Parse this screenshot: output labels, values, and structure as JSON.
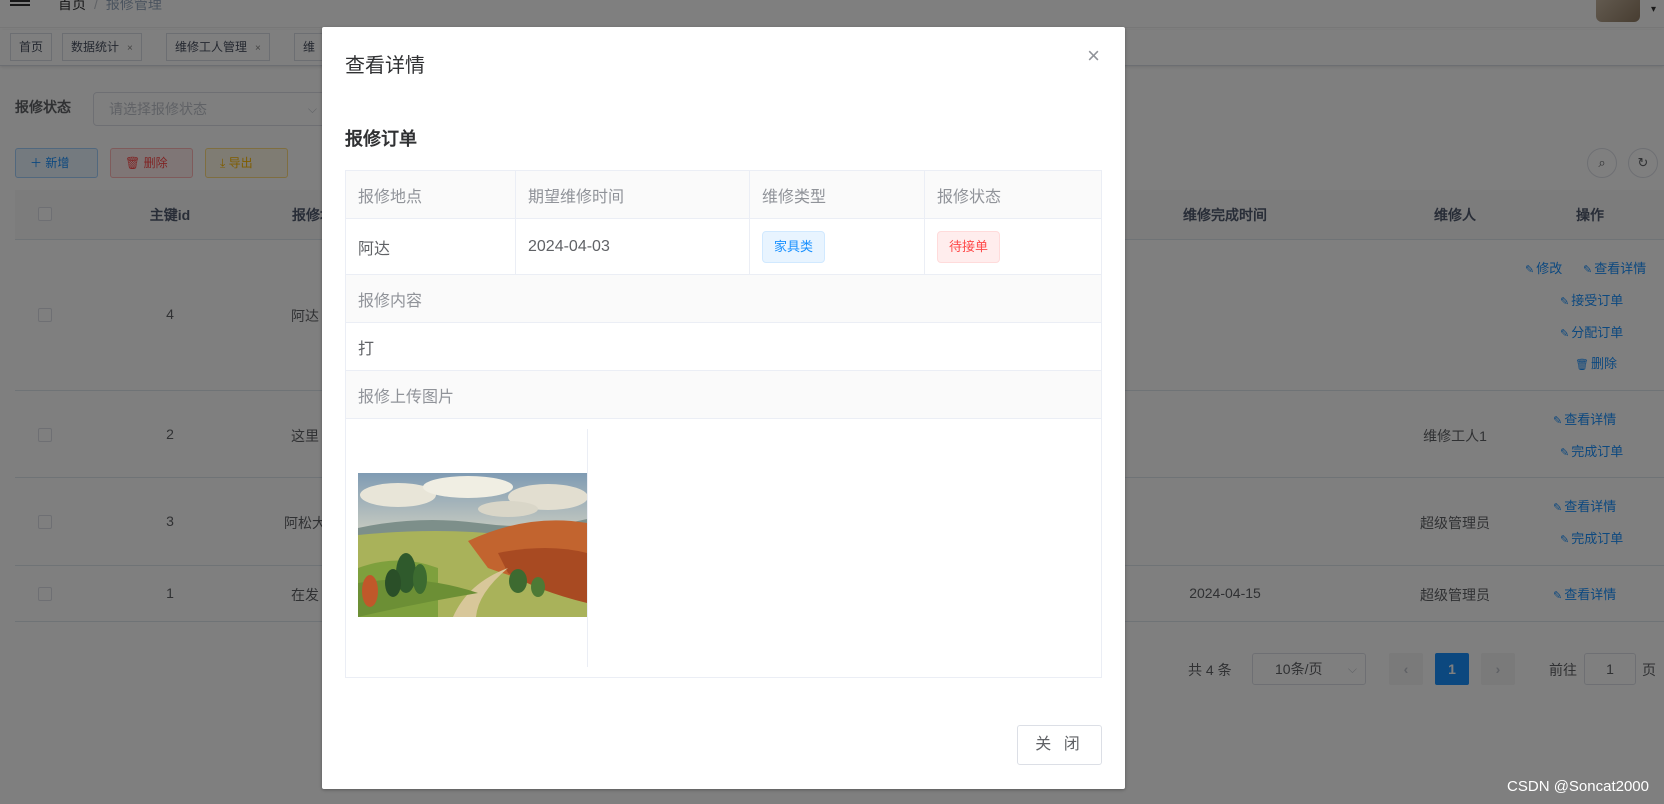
{
  "breadcrumb": {
    "home": "首页",
    "current": "报修管理"
  },
  "tags": [
    {
      "label": "首页",
      "closable": false
    },
    {
      "label": "数据统计",
      "closable": true
    },
    {
      "label": "维修工人管理",
      "closable": true
    },
    {
      "label": "维",
      "closable": false
    }
  ],
  "search": {
    "label": "报修状态",
    "placeholder": "请选择报修状态"
  },
  "toolbar": {
    "add": "新增",
    "delete": "删除",
    "export": "导出"
  },
  "table": {
    "headers": [
      "主键id",
      "报修地点",
      "维修完成时间",
      "维修人",
      "操作"
    ],
    "rows": [
      {
        "id": "4",
        "place": "阿达",
        "finish_time": "",
        "worker": "",
        "ops": [
          "修改",
          "查看详情",
          "接受订单",
          "分配订单",
          "删除"
        ]
      },
      {
        "id": "2",
        "place": "这里",
        "finish_time": "",
        "worker": "维修工人1",
        "ops": [
          "查看详情",
          "完成订单"
        ]
      },
      {
        "id": "3",
        "place": "阿松大",
        "finish_time": "",
        "worker": "超级管理员",
        "ops": [
          "查看详情",
          "完成订单"
        ]
      },
      {
        "id": "1",
        "place": "在发",
        "finish_time": "2024-04-15",
        "worker": "超级管理员",
        "ops": [
          "查看详情"
        ]
      }
    ]
  },
  "pagination": {
    "total": "共 4 条",
    "page_size": "10条/页",
    "current": "1",
    "goto_prefix": "前往",
    "goto_value": "1",
    "goto_suffix": "页"
  },
  "dialog": {
    "title": "查看详情",
    "section_title": "报修订单",
    "labels": {
      "place": "报修地点",
      "expected_time": "期望维修时间",
      "type": "维修类型",
      "status": "报修状态",
      "content": "报修内容",
      "image": "报修上传图片"
    },
    "values": {
      "place": "阿达",
      "expected_time": "2024-04-03",
      "type": "家具类",
      "status": "待接单",
      "content": "打"
    },
    "close_button": "关 闭"
  },
  "watermark": "CSDN @Soncat2000",
  "colors": {
    "primary": "#1890ff",
    "danger": "#ff4949",
    "warning": "#ffba00"
  }
}
